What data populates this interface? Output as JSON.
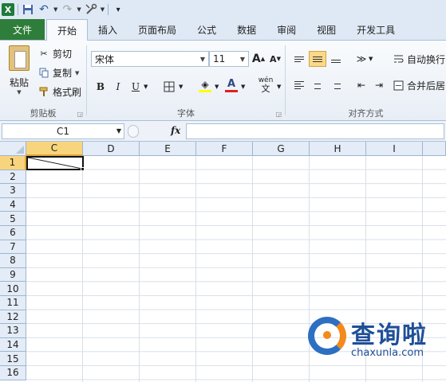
{
  "quick_access": {
    "logo": "X",
    "undo_arrow": "↶",
    "redo_arrow": "↷",
    "customize": "▾"
  },
  "tabs": [
    {
      "label": "文件"
    },
    {
      "label": "开始"
    },
    {
      "label": "插入"
    },
    {
      "label": "页面布局"
    },
    {
      "label": "公式"
    },
    {
      "label": "数据"
    },
    {
      "label": "审阅"
    },
    {
      "label": "视图"
    },
    {
      "label": "开发工具"
    }
  ],
  "active_tab": "开始",
  "clipboard": {
    "group_label": "剪贴板",
    "paste_label": "粘贴",
    "cut_label": "剪切",
    "copy_label": "复制",
    "format_painter_label": "格式刷"
  },
  "font": {
    "group_label": "字体",
    "font_name": "宋体",
    "font_size": "11",
    "grow_label": "A",
    "shrink_label": "A",
    "bold": "B",
    "italic": "I",
    "underline": "U",
    "font_color_label": "A",
    "phonetic_label": "wén"
  },
  "alignment": {
    "group_label": "对齐方式",
    "wrap_text_label": "自动换行",
    "merge_center_label": "合并后居"
  },
  "formula_bar": {
    "name_box": "C1",
    "fx_label": "fx",
    "formula": ""
  },
  "columns": [
    "C",
    "D",
    "E",
    "F",
    "G",
    "H",
    "I"
  ],
  "selected_column": "C",
  "rows": [
    "1",
    "2",
    "3",
    "4",
    "5",
    "6",
    "7",
    "8",
    "9",
    "10",
    "11",
    "12",
    "13",
    "14",
    "15",
    "16"
  ],
  "selected_row": "1",
  "active_cell": "C1",
  "watermark": {
    "text": "查询啦",
    "url": "chaxunla.com"
  },
  "colors": {
    "file_tab": "#2e7d3a",
    "selection_header": "#f8d57c",
    "watermark_blue": "#1f4f98",
    "watermark_orange": "#f28a1c"
  }
}
